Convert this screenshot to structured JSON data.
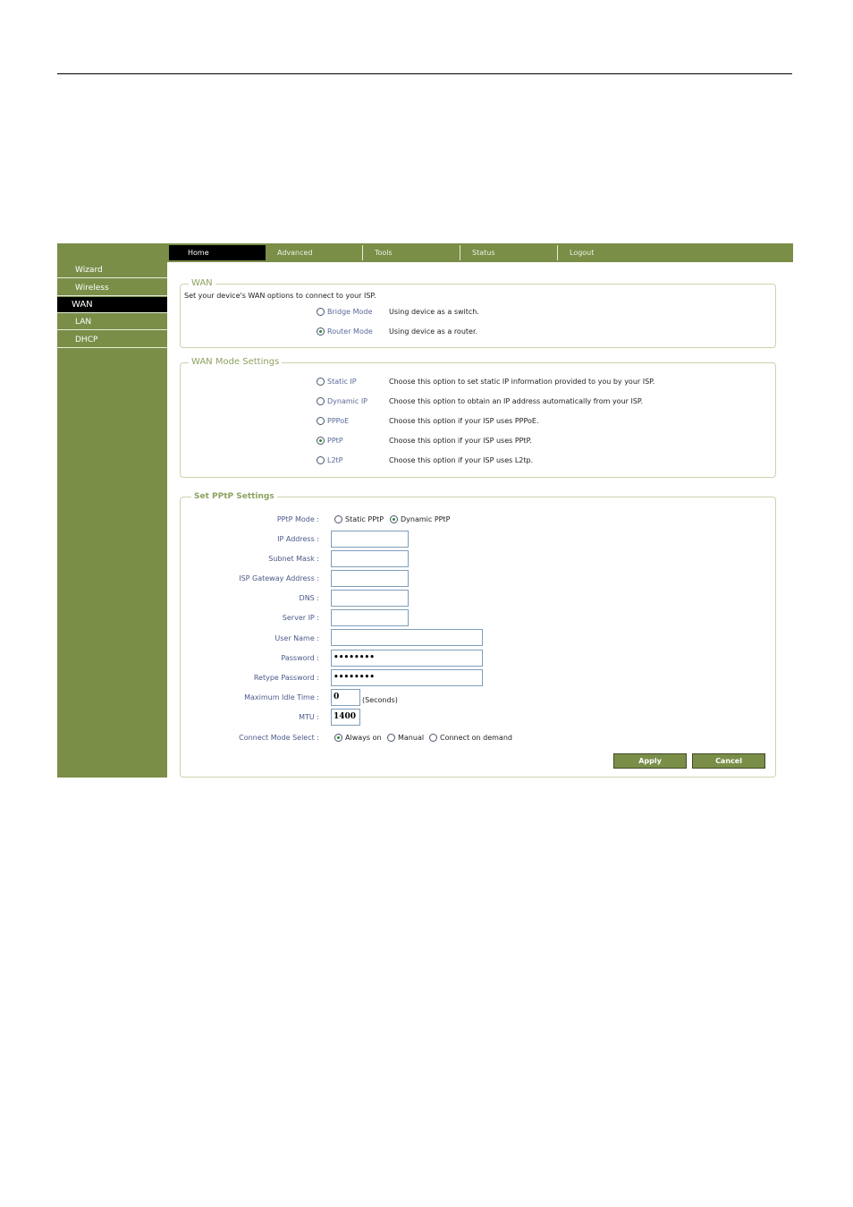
{
  "nav": {
    "tabs": [
      "Home",
      "Advanced",
      "Tools",
      "Status",
      "Logout"
    ],
    "active_tab": "Home"
  },
  "sidebar": {
    "items": [
      "Wizard",
      "Wireless",
      "WAN",
      "LAN",
      "DHCP"
    ],
    "active_item": "WAN"
  },
  "wan": {
    "legend": "WAN",
    "description": "Set your device's WAN options to connect to your ISP.",
    "options": [
      {
        "label": "Bridge Mode",
        "desc": "Using device as a switch.",
        "selected": false
      },
      {
        "label": "Router Mode",
        "desc": "Using device as a router.",
        "selected": true
      }
    ]
  },
  "wan_mode": {
    "legend": "WAN Mode Settings",
    "options": [
      {
        "label": "Static IP",
        "desc": "Choose this option to set static IP information provided to you by your ISP.",
        "selected": false
      },
      {
        "label": "Dynamic IP",
        "desc": "Choose this option to obtain an IP address automatically from your ISP.",
        "selected": false
      },
      {
        "label": "PPPoE",
        "desc": "Choose this option if your ISP uses PPPoE.",
        "selected": false
      },
      {
        "label": "PPtP",
        "desc": "Choose this option if your ISP uses PPtP.",
        "selected": true
      },
      {
        "label": "L2tP",
        "desc": "Choose this option if your ISP uses L2tp.",
        "selected": false
      }
    ]
  },
  "pptp": {
    "legend": "Set PPtP Settings",
    "mode": {
      "label": "PPtP Mode :",
      "options": [
        "Static PPtP",
        "Dynamic PPtP"
      ],
      "selected": "Dynamic PPtP"
    },
    "ip_address": {
      "label": "IP Address :",
      "value": ""
    },
    "subnet_mask": {
      "label": "Subnet Mask :",
      "value": ""
    },
    "gateway": {
      "label": "ISP Gateway Address :",
      "value": ""
    },
    "dns": {
      "label": "DNS :",
      "value": ""
    },
    "server_ip": {
      "label": "Server IP :",
      "value": ""
    },
    "user_name": {
      "label": "User Name :",
      "value": ""
    },
    "password": {
      "label": "Password :",
      "value": "••••••••"
    },
    "retype_password": {
      "label": "Retype Password :",
      "value": "••••••••"
    },
    "idle_time": {
      "label": "Maximum Idle Time :",
      "value": "0",
      "unit": "(Seconds)"
    },
    "mtu": {
      "label": "MTU :",
      "value": "1400"
    },
    "connect_mode": {
      "label": "Connect Mode Select :",
      "options": [
        "Always on",
        "Manual",
        "Connect on demand"
      ],
      "selected": "Always on"
    }
  },
  "buttons": {
    "apply": "Apply",
    "cancel": "Cancel"
  },
  "colors": {
    "brand_green": "#7a8e48",
    "legend_green": "#8ea160",
    "label_blue": "#4b5a8a"
  }
}
